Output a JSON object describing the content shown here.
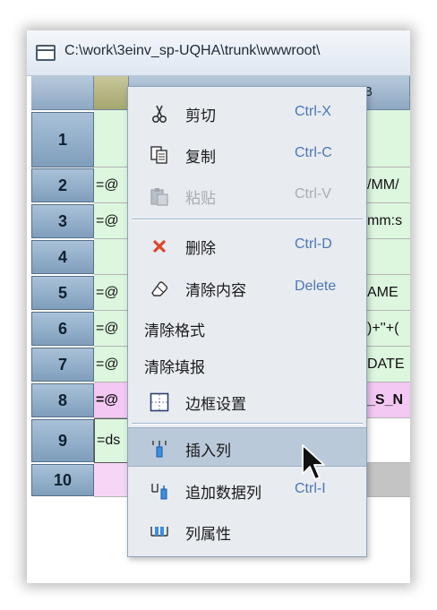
{
  "window": {
    "title": "C:\\work\\3einv_sp-UQHA\\trunk\\wwwroot\\"
  },
  "sheet": {
    "columns": [
      "",
      "B"
    ],
    "rows": [
      {
        "num": "1",
        "a": "",
        "b": ""
      },
      {
        "num": "2",
        "a": "=@",
        "b": "/MM/"
      },
      {
        "num": "3",
        "a": "=@",
        "b": "mm:s"
      },
      {
        "num": "4",
        "a": "",
        "b": ""
      },
      {
        "num": "5",
        "a": "=@",
        "b": "AME"
      },
      {
        "num": "6",
        "a": "=@",
        "b": ")+''+("
      },
      {
        "num": "7",
        "a": "=@",
        "b": "DATE"
      },
      {
        "num": "8",
        "a": "=@",
        "b": "_S_N"
      },
      {
        "num": "9",
        "a": "=ds",
        "b": ""
      },
      {
        "num": "10",
        "a": "",
        "b": ""
      }
    ]
  },
  "context_menu": {
    "items": [
      {
        "label": "剪切",
        "shortcut": "Ctrl-X",
        "icon": "scissors-icon",
        "disabled": false
      },
      {
        "label": "复制",
        "shortcut": "Ctrl-C",
        "icon": "copy-icon",
        "disabled": false
      },
      {
        "label": "粘贴",
        "shortcut": "Ctrl-V",
        "icon": "paste-icon",
        "disabled": true
      },
      {
        "label": "删除",
        "shortcut": "Ctrl-D",
        "icon": "delete-x-icon",
        "disabled": false
      },
      {
        "label": "清除内容",
        "shortcut": "Delete",
        "icon": "eraser-icon",
        "disabled": false
      },
      {
        "label": "清除格式",
        "shortcut": "",
        "icon": "",
        "disabled": false
      },
      {
        "label": "清除填报",
        "shortcut": "",
        "icon": "",
        "disabled": false
      },
      {
        "label": "边框设置",
        "shortcut": "",
        "icon": "border-grid-icon",
        "disabled": false
      },
      {
        "label": "插入列",
        "shortcut": "",
        "icon": "insert-column-icon",
        "disabled": false,
        "highlighted": true
      },
      {
        "label": "追加数据列",
        "shortcut": "Ctrl-I",
        "icon": "append-column-icon",
        "disabled": false
      },
      {
        "label": "列属性",
        "shortcut": "",
        "icon": "column-properties-icon",
        "disabled": false
      }
    ]
  },
  "colors": {
    "menu_bg": "#e8ecf1",
    "highlight": "#bac9d9",
    "shortcut": "#4c76b7",
    "cell_green": "#ddf7df",
    "cell_pink": "#f3c8f3",
    "header_blue": "#8ea9c4"
  }
}
